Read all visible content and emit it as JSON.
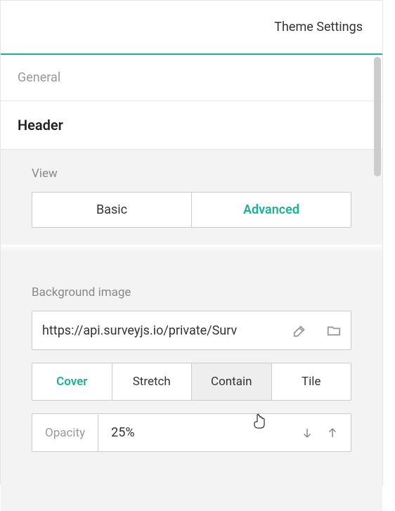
{
  "title": "Theme Settings",
  "sections": {
    "general": "General",
    "header": "Header"
  },
  "view": {
    "label": "View",
    "basic": "Basic",
    "advanced": "Advanced"
  },
  "bg": {
    "label": "Background image",
    "url": "https://api.surveyjs.io/private/Surv",
    "fits": {
      "cover": "Cover",
      "stretch": "Stretch",
      "contain": "Contain",
      "tile": "Tile"
    },
    "opacity": {
      "label": "Opacity",
      "value": "25%"
    }
  }
}
